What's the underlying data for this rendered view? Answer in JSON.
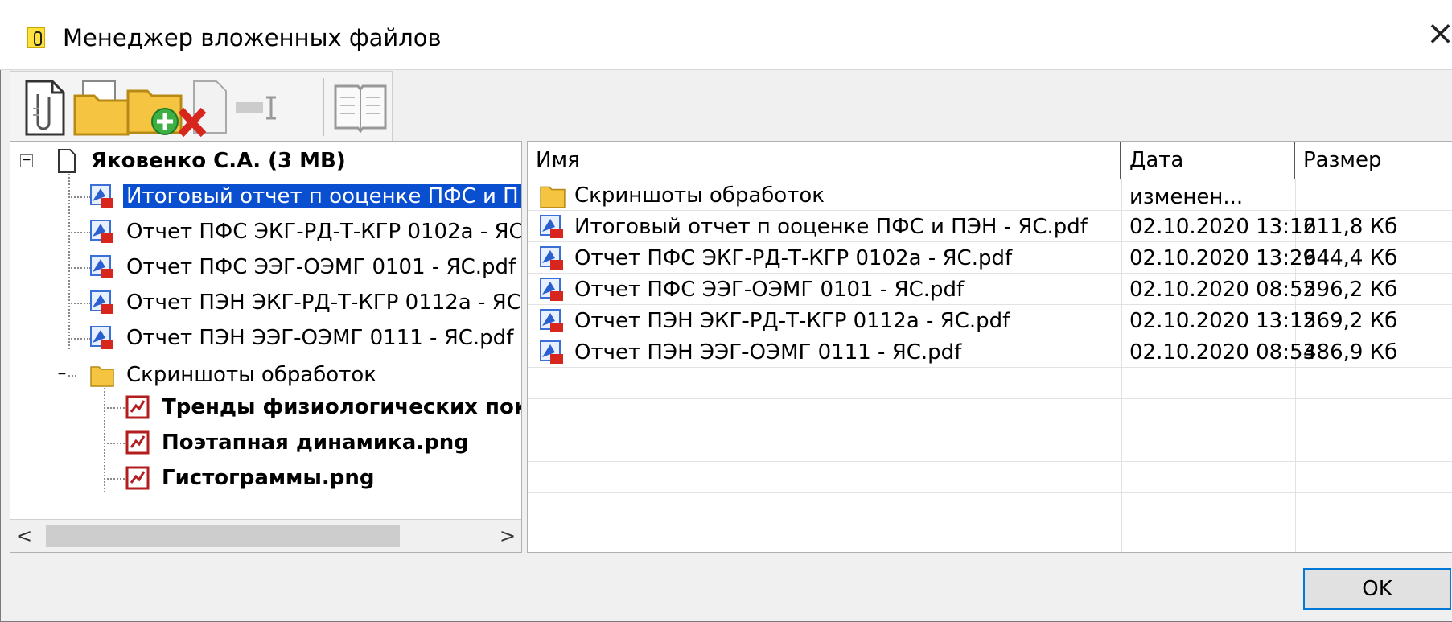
{
  "window": {
    "title": "Менеджер вложенных файлов",
    "close_symbol": "×",
    "icon": "paperclip-icon"
  },
  "toolbar": {
    "buttons": [
      {
        "name": "attach-file-icon"
      },
      {
        "name": "open-folder-icon"
      },
      {
        "name": "add-folder-icon"
      },
      {
        "name": "delete-file-icon"
      },
      {
        "name": "rename-icon"
      },
      {
        "name": "read-book-icon"
      }
    ]
  },
  "tree": {
    "root": "Яковенко С.А. (3 MB)",
    "items": [
      "Итоговый отчет п ооценке ПФС и П",
      "Отчет ПФС ЭКГ-РД-Т-КГР 0102а - ЯС",
      "Отчет ПФС ЭЭГ-ОЭМГ 0101 - ЯС.pdf",
      "Отчет ПЭН ЭКГ-РД-Т-КГР 0112а - ЯС",
      "Отчет ПЭН ЭЭГ-ОЭМГ 0111 - ЯС.pdf"
    ],
    "folder": "Скриншоты обработок",
    "folder_items": [
      "Тренды физиологических показ",
      "Поэтапная динамика.png",
      "Гистограммы.png"
    ],
    "expander_symbol": "−",
    "scroll_left": "<",
    "scroll_right": ">"
  },
  "list": {
    "columns": [
      "Имя",
      "Дата изменен...",
      "Размер"
    ],
    "rows": [
      {
        "name": "Скриншоты обработок",
        "date": "",
        "size": ""
      },
      {
        "name": "Итоговый отчет п ооценке ПФС и ПЭН - ЯС.pdf",
        "date": "02.10.2020 13:12",
        "size": "611,8 Кб"
      },
      {
        "name": "Отчет ПФС ЭКГ-РД-Т-КГР 0102а - ЯС.pdf",
        "date": "02.10.2020 13:29",
        "size": "644,4 Кб"
      },
      {
        "name": "Отчет ПФС ЭЭГ-ОЭМГ 0101 - ЯС.pdf",
        "date": "02.10.2020 08:52",
        "size": "596,2 Кб"
      },
      {
        "name": "Отчет ПЭН ЭКГ-РД-Т-КГР 0112а - ЯС.pdf",
        "date": "02.10.2020 13:12",
        "size": "569,2 Кб"
      },
      {
        "name": "Отчет ПЭН ЭЭГ-ОЭМГ 0111 - ЯС.pdf",
        "date": "02.10.2020 08:53",
        "size": "486,9 Кб"
      }
    ]
  },
  "buttons": {
    "ok": "OK"
  },
  "colors": {
    "selection": "#0a4fcf",
    "accent": "#0078d7",
    "folder": "#f5c542"
  }
}
